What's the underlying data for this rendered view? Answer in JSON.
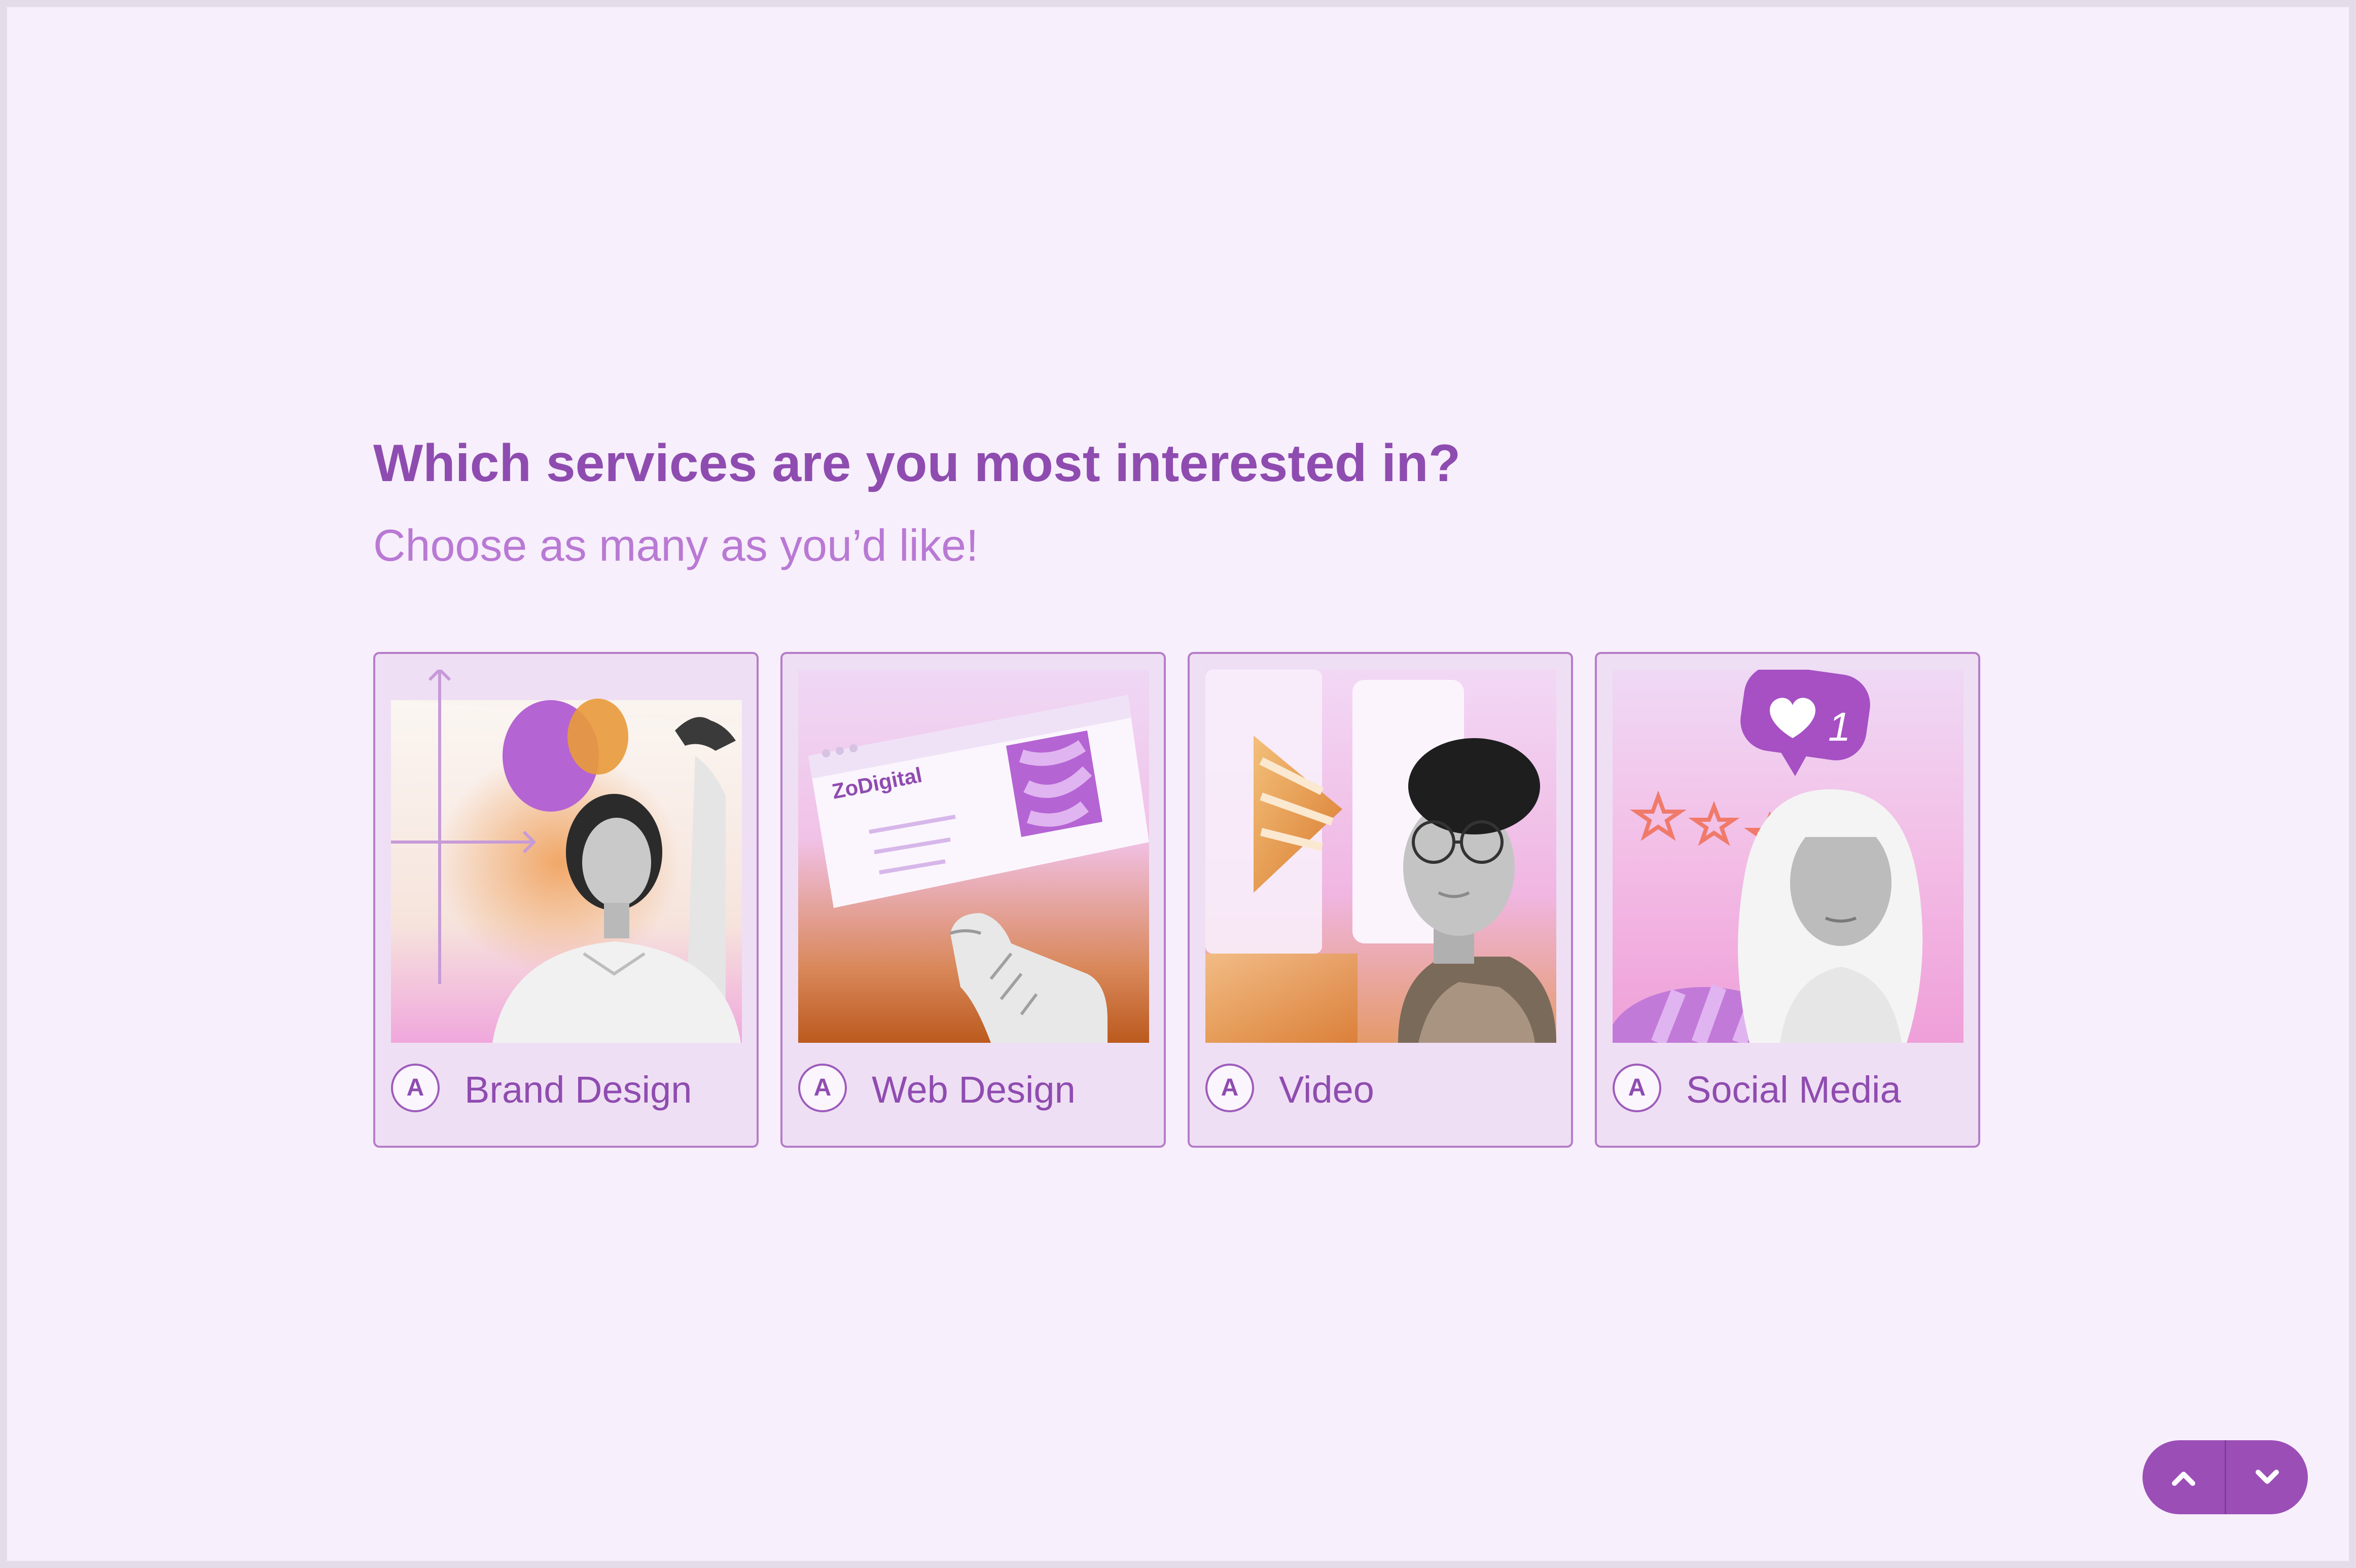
{
  "question": {
    "title": "Which services are you most interested in?",
    "subtitle": "Choose as many as you’d like!"
  },
  "options": [
    {
      "key": "A",
      "label": "Brand Design"
    },
    {
      "key": "A",
      "label": "Web Design"
    },
    {
      "key": "A",
      "label": "Video"
    },
    {
      "key": "A",
      "label": "Social Media"
    }
  ],
  "web_design_card_brand": "ZoDigital",
  "social_like_count": "1",
  "navigation": {
    "up_icon": "chevron-up-icon",
    "down_icon": "chevron-down-icon"
  },
  "colors": {
    "page_background": "#f7effb",
    "accent": "#9b4eb6",
    "title_text": "#8f4cb0",
    "subtitle_text": "#b979d4",
    "card_background": "#efdff4",
    "card_border": "#b57dc9"
  }
}
